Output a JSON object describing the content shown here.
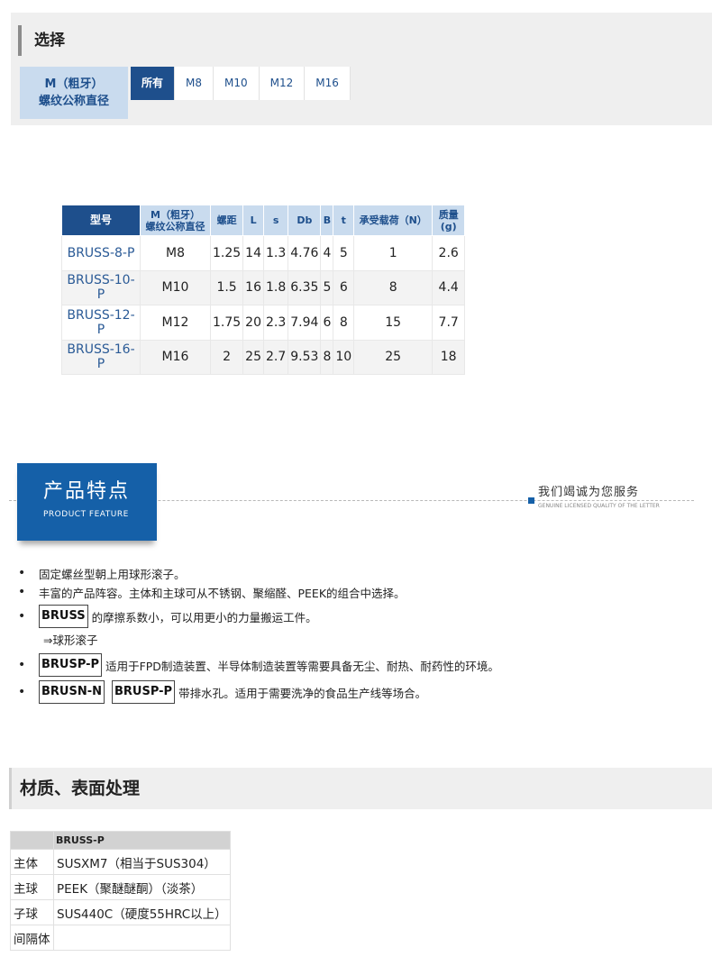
{
  "selection": {
    "title": "选择",
    "filter_label_line1": "M（粗牙）",
    "filter_label_line2": "螺纹公称直径",
    "options": [
      "所有",
      "M8",
      "M10",
      "M12",
      "M16"
    ]
  },
  "spec_table": {
    "headers": {
      "model": "型号",
      "thread_line1": "M（粗牙）",
      "thread_line2": "螺纹公称直径",
      "pitch": "螺距",
      "L": "L",
      "s": "s",
      "Db": "Db",
      "B": "B",
      "t": "t",
      "load": "承受载荷（N）",
      "mass_line1": "质量",
      "mass_line2": "(g)"
    },
    "rows": [
      {
        "model": "BRUSS-8-P",
        "thread": "M8",
        "pitch": "1.25",
        "L": "14",
        "s": "1.3",
        "Db": "4.76",
        "B": "4",
        "t": "5",
        "load": "1",
        "mass": "2.6"
      },
      {
        "model": "BRUSS-10-P",
        "thread": "M10",
        "pitch": "1.5",
        "L": "16",
        "s": "1.8",
        "Db": "6.35",
        "B": "5",
        "t": "6",
        "load": "8",
        "mass": "4.4"
      },
      {
        "model": "BRUSS-12-P",
        "thread": "M12",
        "pitch": "1.75",
        "L": "20",
        "s": "2.3",
        "Db": "7.94",
        "B": "6",
        "t": "8",
        "load": "15",
        "mass": "7.7"
      },
      {
        "model": "BRUSS-16-P",
        "thread": "M16",
        "pitch": "2",
        "L": "25",
        "s": "2.7",
        "Db": "9.53",
        "B": "8",
        "t": "10",
        "load": "25",
        "mass": "18"
      }
    ]
  },
  "feature_banner": {
    "title_cn": "产品特点",
    "title_en": "PRODUCT FEATURE",
    "slogan_cn": "我们竭诚为您服务",
    "slogan_en": "GENUINE LICENSED QUALITY OF THE LETTER"
  },
  "features": {
    "item1": "固定螺丝型朝上用球形滚子。",
    "item2": "丰富的产品阵容。主体和主球可从不锈钢、聚缩醛、PEEK的组合中选择。",
    "item3_tag": "BRUSS",
    "item3_text": "的摩擦系数小，可以用更小的力量搬运工件。",
    "item3_sub": "⇒球形滚子",
    "item4_tag": "BRUSP-P",
    "item4_text": "适用于FPD制造装置、半导体制造装置等需要具备无尘、耐热、耐药性的环境。",
    "item5_tag1": "BRUSN-N",
    "item5_tag2": "BRUSP-P",
    "item5_text": "带排水孔。适用于需要洗净的食品生产线等场合。"
  },
  "material": {
    "title": "材质、表面处理",
    "column_header": "BRUSS-P",
    "rows": [
      {
        "label": "主体",
        "value": "SUSXM7（相当于SUS304）"
      },
      {
        "label": "主球",
        "value": "PEEK（聚醚醚酮）（淡茶）"
      },
      {
        "label": "子球",
        "value": "SUS440C（硬度55HRC以上）"
      },
      {
        "label": "间隔体",
        "value": ""
      }
    ]
  }
}
